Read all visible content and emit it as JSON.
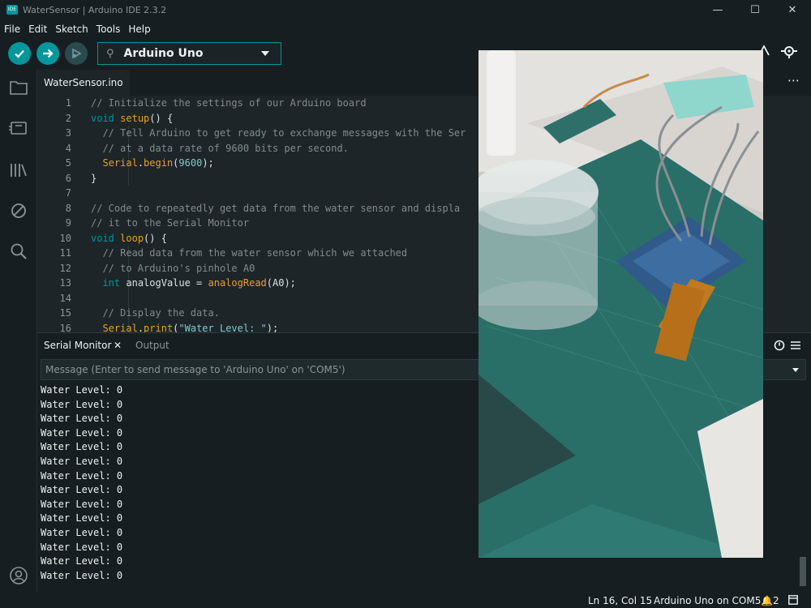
{
  "window": {
    "title": "WaterSensor | Arduino IDE 2.3.2",
    "app_icon_text": "IDE",
    "controls": [
      "—",
      "☐",
      "✕"
    ]
  },
  "menu": [
    "File",
    "Edit",
    "Sketch",
    "Tools",
    "Help"
  ],
  "toolbar": {
    "verify_icon": "check-icon",
    "upload_icon": "arrow-right-icon",
    "debug_icon": "debug-icon",
    "board": "Arduino Uno",
    "usb_icon": "usb-icon",
    "serial_plotter_icon": "serial-plotter-icon",
    "serial_monitor_icon": "serial-monitor-icon"
  },
  "sidebar": {
    "items": [
      "sketchbook-icon",
      "boards-manager-icon",
      "library-manager-icon",
      "debug-icon",
      "search-icon"
    ],
    "bottom": "profile-icon"
  },
  "editor": {
    "tab": "WaterSensor.ino",
    "more": "⋯",
    "lines": [
      {
        "n": "1",
        "html": "<span class=\"c-com\">// Initialize the settings of our Arduino board</span>"
      },
      {
        "n": "2",
        "html": "<span class=\"c-kw\">void</span> <span class=\"c-fn\">setup</span>() {"
      },
      {
        "n": "3",
        "html": "  <span class=\"c-com\">// Tell Arduino to get ready to exchange messages with the Ser</span>"
      },
      {
        "n": "4",
        "html": "  <span class=\"c-com\">// at a data rate of 9600 bits per second.</span>"
      },
      {
        "n": "5",
        "html": "  <span class=\"c-fn\">Serial</span>.<span class=\"c-fn\">begin</span>(<span class=\"c-num\">9600</span>);"
      },
      {
        "n": "6",
        "html": "}"
      },
      {
        "n": "7",
        "html": ""
      },
      {
        "n": "8",
        "html": "<span class=\"c-com\">// Code to repeatedly get data from the water sensor and displa</span>"
      },
      {
        "n": "9",
        "html": "<span class=\"c-com\">// it to the Serial Monitor</span>"
      },
      {
        "n": "10",
        "html": "<span class=\"c-kw\">void</span> <span class=\"c-fn\">loop</span>() {"
      },
      {
        "n": "11",
        "html": "  <span class=\"c-com\">// Read data from the water sensor which we attached</span>"
      },
      {
        "n": "12",
        "html": "  <span class=\"c-com\">// to Arduino's pinhole A0</span>"
      },
      {
        "n": "13",
        "html": "  <span class=\"c-kw\">int</span> analogValue = <span class=\"c-fn\">analogRead</span>(A0);"
      },
      {
        "n": "14",
        "html": ""
      },
      {
        "n": "15",
        "html": "  <span class=\"c-com\">// Display the data.</span>"
      },
      {
        "n": "16",
        "html": "  <span class=\"c-fn\">Serial</span>.<span class=\"c-fn\">print</span>(<span class=\"c-str\">\"Water Level: \"</span>);"
      }
    ]
  },
  "panel": {
    "tabs": [
      "Serial Monitor",
      "Output"
    ],
    "close": "✕",
    "input_placeholder": "Message (Enter to send message to 'Arduino Uno' on 'COM5')",
    "serial_lines": [
      "Water Level: 0",
      "Water Level: 0",
      "Water Level: 0",
      "Water Level: 0",
      "Water Level: 0",
      "Water Level: 0",
      "Water Level: 0",
      "Water Level: 0",
      "Water Level: 0",
      "Water Level: 0",
      "Water Level: 0",
      "Water Level: 0",
      "Water Level: 0",
      "Water Level: 0"
    ]
  },
  "status": {
    "position": "Ln 16, Col 15",
    "board_port": "Arduino Uno on COM5",
    "notifications": "2"
  }
}
